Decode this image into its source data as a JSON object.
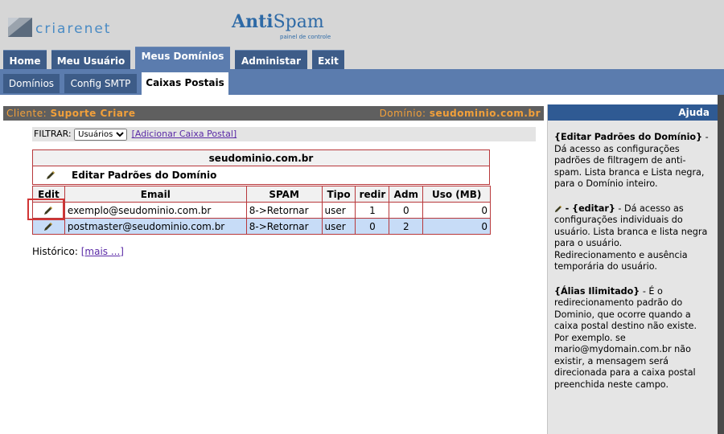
{
  "brand": {
    "name_part1": "criare",
    "name_part2": "net"
  },
  "product": {
    "anti": "Anti",
    "spam": "Spam",
    "subtitle": "painel de controle"
  },
  "main_tabs": [
    {
      "label": "Home"
    },
    {
      "label": "Meu Usuário"
    },
    {
      "label": "Meus Domínios",
      "active": true
    },
    {
      "label": "Administar"
    },
    {
      "label": "Exit"
    }
  ],
  "sub_tabs": [
    {
      "label": "Domínios"
    },
    {
      "label": "Config SMTP"
    },
    {
      "label": "Caixas Postais",
      "active": true
    }
  ],
  "client_bar": {
    "client_label": "Cliente:",
    "client_value": "Suporte Criare",
    "domain_label": "Domínio:",
    "domain_value": "seudominio.com.br"
  },
  "filter": {
    "label": "FILTRAR:",
    "selected": "Usuários",
    "add_link": "[Adicionar Caixa Postal]"
  },
  "domain_box": {
    "title": "seudominio.com.br",
    "edit_label": "Editar Padrões do Domínio"
  },
  "table": {
    "headers": [
      "Edit",
      "Email",
      "SPAM",
      "Tipo",
      "redir",
      "Adm",
      "Uso (MB)"
    ],
    "rows": [
      {
        "email": "exemplo@seudominio.com.br",
        "spam": "8->Retornar",
        "tipo": "user",
        "redir": "1",
        "adm": "0",
        "uso": "0"
      },
      {
        "email": "postmaster@seudominio.com.br",
        "spam": "8->Retornar",
        "tipo": "user",
        "redir": "0",
        "adm": "2",
        "uso": "0"
      }
    ]
  },
  "historico": {
    "label": "Histórico:",
    "link": "[mais ...]"
  },
  "help": {
    "title": "Ajuda",
    "p1_title": "{Editar Padrões do Domínio}",
    "p1_text": " - Dá acesso as configurações padrões de filtragem de anti-spam. Lista branca e Lista negra, para o Domínio inteiro.",
    "p2_title": "- {editar}",
    "p2_text": " - Dá acesso as configurações individuais do usuário. Lista branca e lista negra para o usuário.",
    "p2_text2": "Redirecionamento e ausência temporária do usuário.",
    "p3_title": "{Álias Ilimitado}",
    "p3_text": " - É o redirecionamento padrão do Dominio, que ocorre quando a caixa postal destino não existe.",
    "p3_text2": "Por exemplo. se mario@mydomain.com.br não existir, a mensagem será direcionada para a caixa postal preenchida neste campo."
  },
  "colors": {
    "header_bg": "#d6d6d6",
    "tab_bg": "#3d5c88",
    "tab_active_bg": "#5b7cae",
    "client_text": "#f2a03a",
    "table_border": "#b8383b",
    "alt_row": "#c7dcf7",
    "help_header": "#2f5a93"
  }
}
